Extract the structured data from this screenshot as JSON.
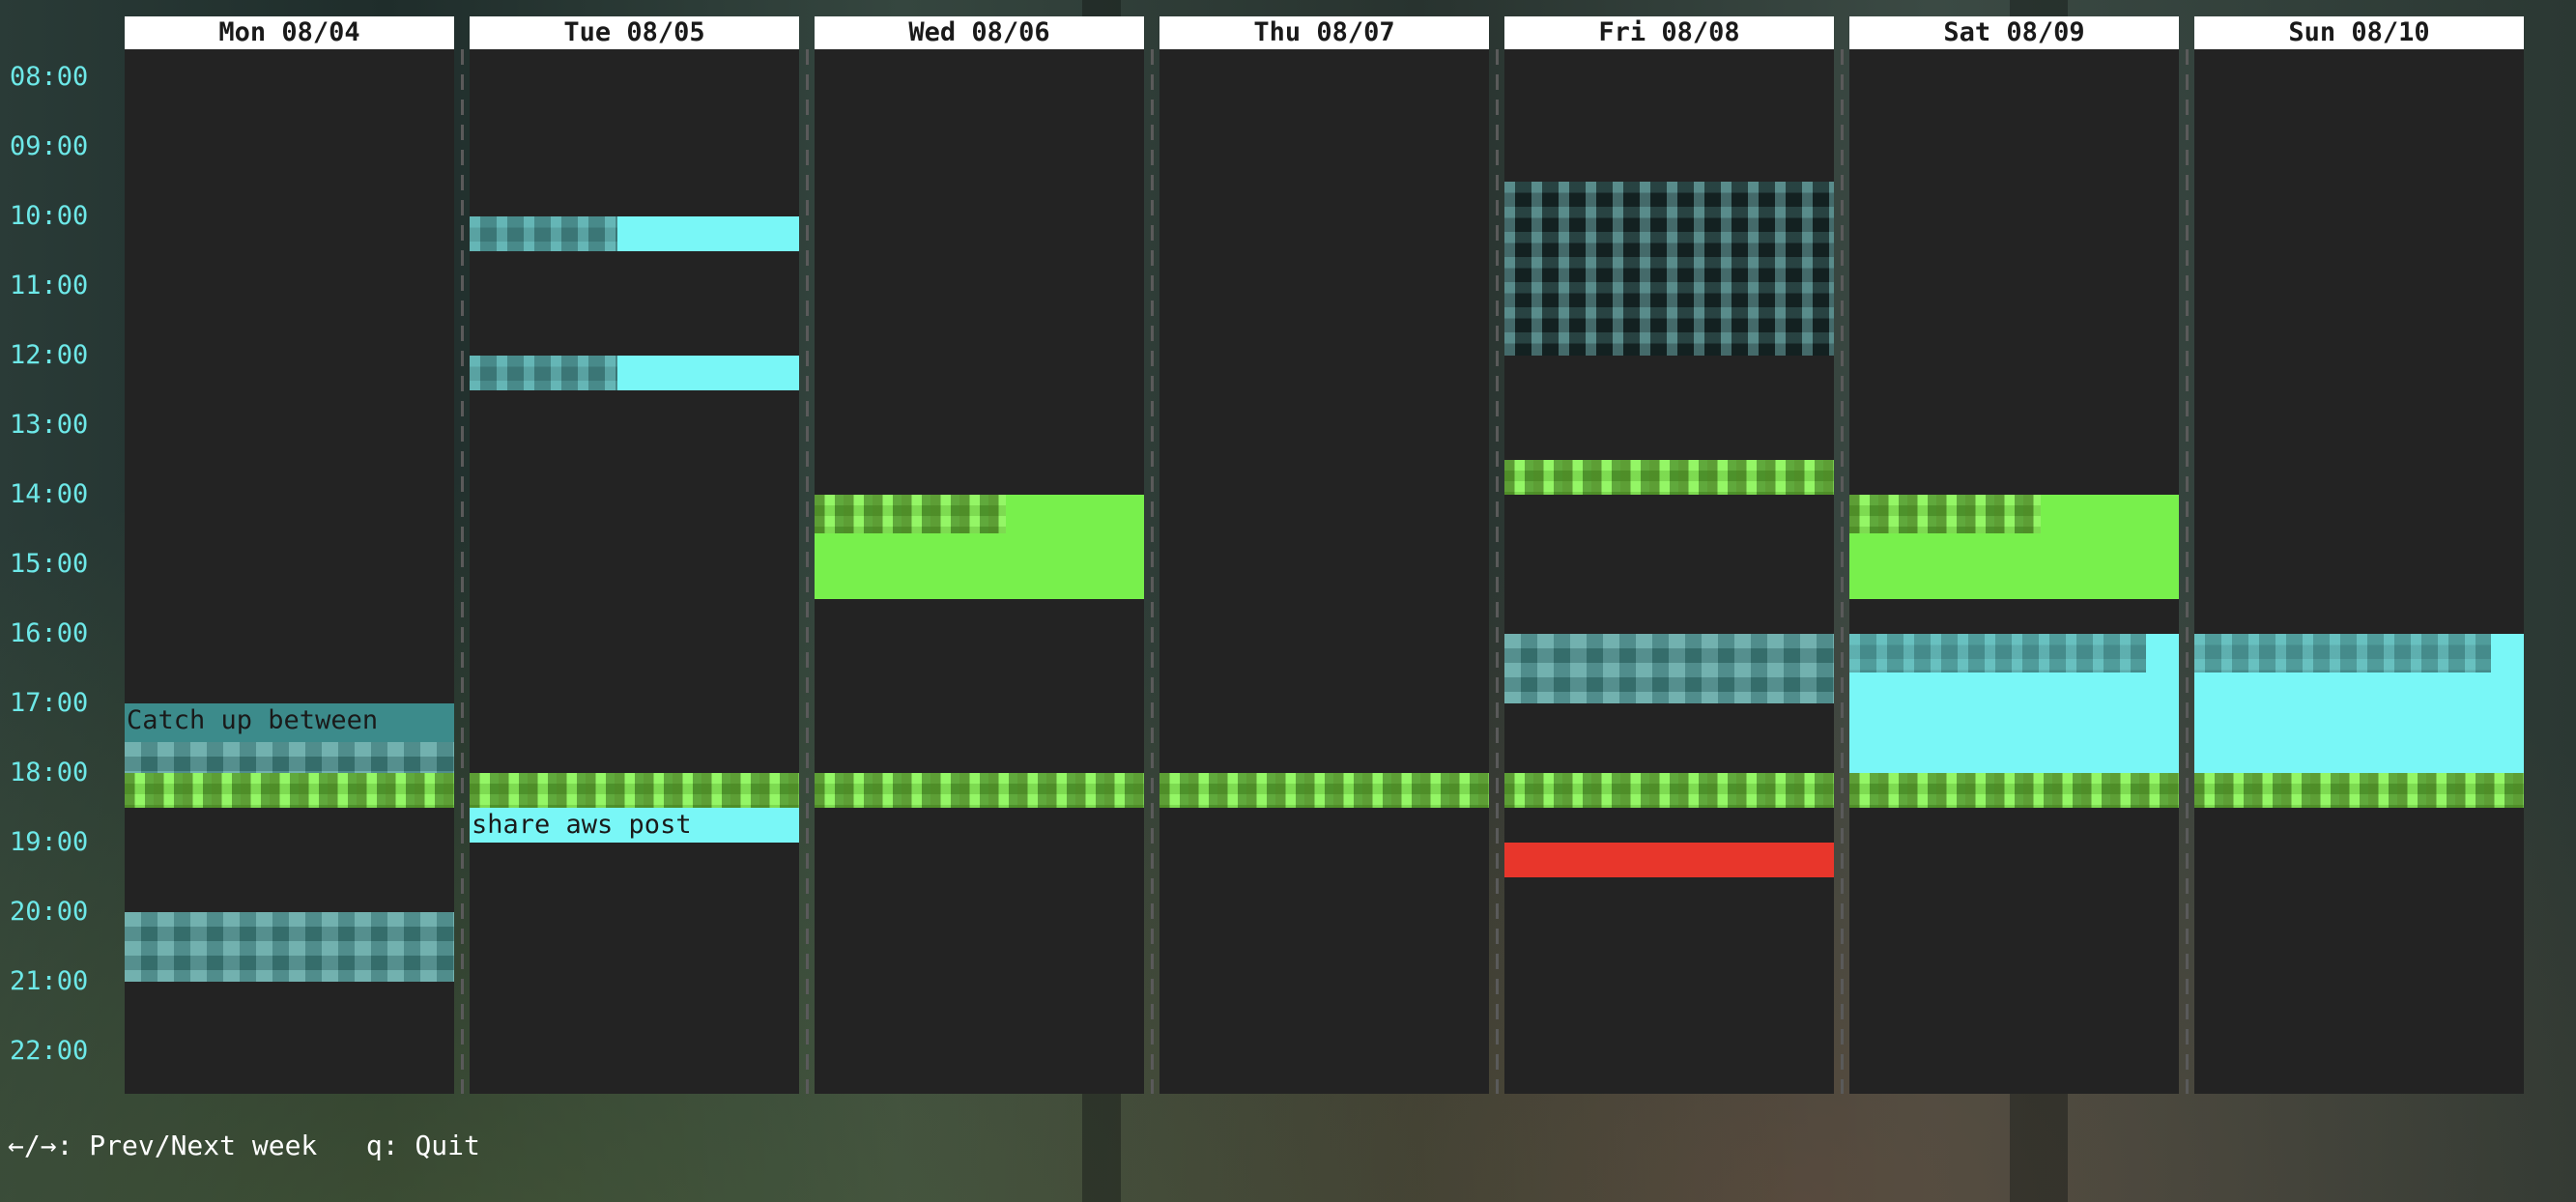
{
  "calendar": {
    "days": [
      {
        "label": "Mon 08/04"
      },
      {
        "label": "Tue 08/05"
      },
      {
        "label": "Wed 08/06"
      },
      {
        "label": "Thu 08/07"
      },
      {
        "label": "Fri 08/08"
      },
      {
        "label": "Sat 08/09"
      },
      {
        "label": "Sun 08/10"
      }
    ],
    "hours": [
      "08:00",
      "09:00",
      "10:00",
      "11:00",
      "12:00",
      "13:00",
      "14:00",
      "15:00",
      "16:00",
      "17:00",
      "18:00",
      "19:00",
      "20:00",
      "21:00",
      "22:00"
    ],
    "events": [
      {
        "day": 0,
        "start": 17.0,
        "end": 18.0,
        "color": "teal",
        "title": "Catch up between"
      },
      {
        "day": 0,
        "start": 18.0,
        "end": 18.5,
        "color": "green",
        "title": ""
      },
      {
        "day": 0,
        "start": 20.0,
        "end": 21.0,
        "color": "teal",
        "title": ""
      },
      {
        "day": 1,
        "start": 10.0,
        "end": 10.5,
        "color": "cyan",
        "title": ""
      },
      {
        "day": 1,
        "start": 12.0,
        "end": 12.5,
        "color": "cyan",
        "title": ""
      },
      {
        "day": 1,
        "start": 18.0,
        "end": 18.5,
        "color": "green",
        "title": ""
      },
      {
        "day": 1,
        "start": 18.5,
        "end": 19.0,
        "color": "cyan",
        "title": "share aws post"
      },
      {
        "day": 2,
        "start": 14.0,
        "end": 15.5,
        "color": "green",
        "title": ""
      },
      {
        "day": 2,
        "start": 18.0,
        "end": 18.5,
        "color": "green",
        "title": ""
      },
      {
        "day": 3,
        "start": 18.0,
        "end": 18.5,
        "color": "green",
        "title": ""
      },
      {
        "day": 4,
        "start": 9.5,
        "end": 12.0,
        "color": "cyan",
        "title": ""
      },
      {
        "day": 4,
        "start": 13.5,
        "end": 14.0,
        "color": "green",
        "title": ""
      },
      {
        "day": 4,
        "start": 16.0,
        "end": 17.0,
        "color": "teal",
        "title": ""
      },
      {
        "day": 4,
        "start": 18.0,
        "end": 18.5,
        "color": "green",
        "title": ""
      },
      {
        "day": 4,
        "start": 19.0,
        "end": 19.5,
        "color": "red",
        "title": ""
      },
      {
        "day": 5,
        "start": 14.0,
        "end": 15.5,
        "color": "green",
        "title": ""
      },
      {
        "day": 5,
        "start": 16.0,
        "end": 18.0,
        "color": "cyan",
        "title": ""
      },
      {
        "day": 5,
        "start": 18.0,
        "end": 18.5,
        "color": "green",
        "title": ""
      },
      {
        "day": 6,
        "start": 16.0,
        "end": 18.0,
        "color": "cyan",
        "title": ""
      },
      {
        "day": 6,
        "start": 18.0,
        "end": 18.5,
        "color": "green",
        "title": ""
      }
    ]
  },
  "footer": {
    "nav_hint": "←/→: Prev/Next week",
    "quit_hint": "q: Quit"
  },
  "colors": {
    "cyan": "#79f7f7",
    "green": "#78f04c",
    "teal": "#3c8b8b",
    "red": "#e8362b",
    "time_label": "#6de8e8",
    "panel": "#232323"
  }
}
